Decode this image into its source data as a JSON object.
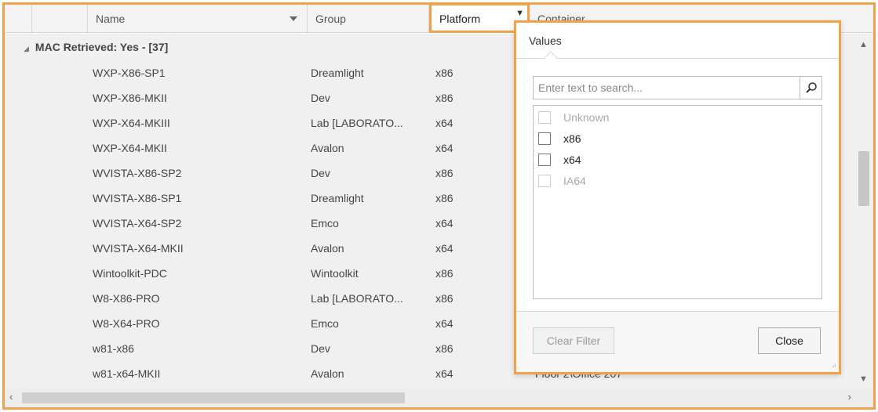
{
  "grid": {
    "columns": {
      "name": "Name",
      "group": "Group",
      "platform": "Platform",
      "container": "Container"
    },
    "group_header": "MAC Retrieved: Yes - [37]",
    "rows": [
      {
        "name": "WXP-X86-SP1",
        "group": "Dreamlight",
        "platform": "x86",
        "status": "blue"
      },
      {
        "name": "WXP-X86-MKII",
        "group": "Dev",
        "platform": "x86",
        "status": "green"
      },
      {
        "name": "WXP-X64-MKIII",
        "group": "Lab [LABORATO...",
        "platform": "x64",
        "status": "red"
      },
      {
        "name": "WXP-X64-MKII",
        "group": "Avalon",
        "platform": "x64",
        "status": "green"
      },
      {
        "name": "WVISTA-X86-SP2",
        "group": "Dev",
        "platform": "x86",
        "status": "green"
      },
      {
        "name": "WVISTA-X86-SP1",
        "group": "Dreamlight",
        "platform": "x86",
        "status": "green"
      },
      {
        "name": "WVISTA-X64-SP2",
        "group": "Emco",
        "platform": "x64",
        "status": "red"
      },
      {
        "name": "WVISTA-X64-MKII",
        "group": "Avalon",
        "platform": "x64",
        "status": "green"
      },
      {
        "name": "Wintoolkit-PDC",
        "group": "Wintoolkit",
        "platform": "x86",
        "status": "gray"
      },
      {
        "name": "W8-X86-PRO",
        "group": "Lab [LABORATO...",
        "platform": "x86",
        "status": "green"
      },
      {
        "name": "W8-X64-PRO",
        "group": "Emco",
        "platform": "x64",
        "status": "green"
      },
      {
        "name": "w81-x86",
        "group": "Dev",
        "platform": "x86",
        "status": "green"
      },
      {
        "name": "w81-x64-MKII",
        "group": "Avalon",
        "platform": "x64",
        "status": "green",
        "container": "Floor 2\\Office 207"
      }
    ]
  },
  "filter_popup": {
    "title": "Values",
    "search_placeholder": "Enter text to search...",
    "options": [
      {
        "label": "Unknown",
        "enabled": false,
        "checked": false
      },
      {
        "label": "x86",
        "enabled": true,
        "checked": false
      },
      {
        "label": "x64",
        "enabled": true,
        "checked": false
      },
      {
        "label": "IA64",
        "enabled": false,
        "checked": false
      }
    ],
    "clear_label": "Clear Filter",
    "close_label": "Close"
  },
  "colors": {
    "highlight": "#f0a24a",
    "status_green": "#4caf50",
    "status_blue": "#3b7dd8",
    "status_red": "#d83b3b"
  }
}
